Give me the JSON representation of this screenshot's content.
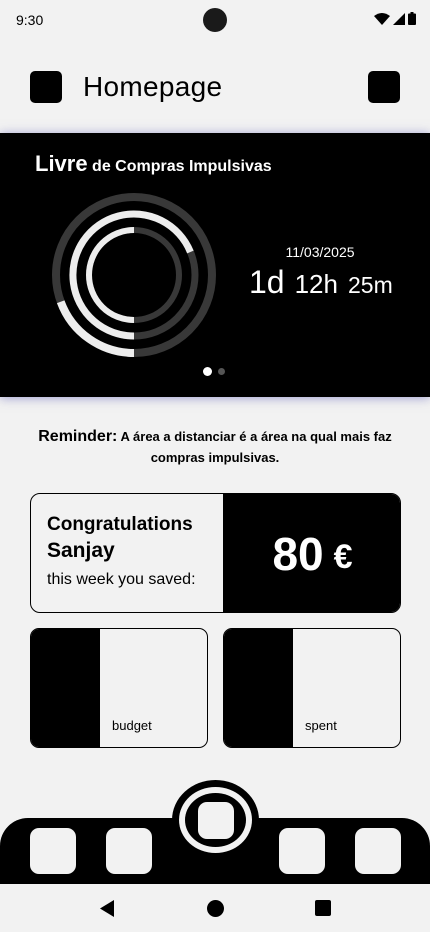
{
  "status_bar": {
    "time": "9:30"
  },
  "header": {
    "title": "Homepage"
  },
  "hero": {
    "title_strong": "Livre",
    "title_rest": "de Compras Impulsivas",
    "date": "11/03/2025",
    "timer": {
      "days": "1d",
      "hours": "12h",
      "minutes": "25m"
    },
    "carousel": {
      "pages": 2,
      "active_page": 1
    }
  },
  "reminder": {
    "label": "Reminder:",
    "text": "A área a distanciar é a área na qual mais faz compras impulsivas."
  },
  "savings": {
    "congrats": "Congratulations",
    "name": "Sanjay",
    "week_label": "this week you saved:",
    "amount": "80",
    "currency": "€"
  },
  "cards": {
    "budget_label": "budget",
    "spent_label": "spent"
  },
  "colors": {
    "primary": "#000000",
    "background": "#f2f2f2",
    "hero_glow": "#5a5ab4"
  }
}
